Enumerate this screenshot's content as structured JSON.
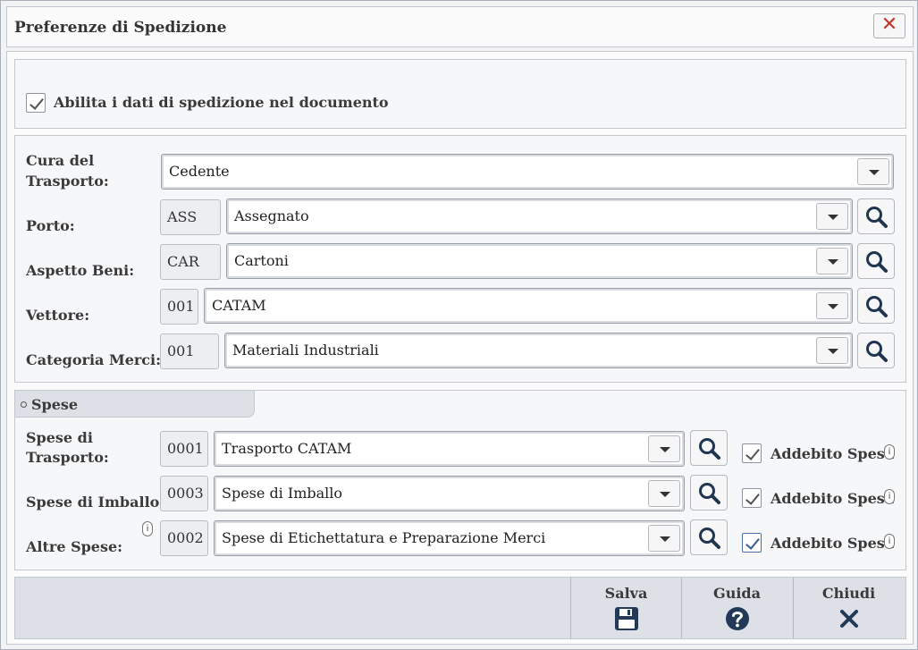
{
  "window": {
    "title": "Preferenze di Spedizione",
    "close_symbol": "✕"
  },
  "enable": {
    "label": "Abilita i dati di spedizione nel documento",
    "checked": true
  },
  "transport": {
    "cura": {
      "label_1": "Cura del",
      "label_2": "Trasporto:",
      "value": "Cedente"
    },
    "porto": {
      "label": "Porto:",
      "code": "ASS",
      "value": "Assegnato"
    },
    "aspetto": {
      "label": "Aspetto Beni:",
      "code": "CAR",
      "value": "Cartoni"
    },
    "vettore": {
      "label": "Vettore:",
      "code": "001",
      "value": "CATAM"
    },
    "categoria": {
      "label": "Categoria Merci:",
      "code": "001",
      "value": "Materiali Industriali"
    }
  },
  "spese": {
    "section_title": "Spese",
    "trasporto": {
      "label_1": "Spese di",
      "label_2": "Trasporto:",
      "code": "0001",
      "value": "Trasporto CATAM",
      "addebito_label": "Addebito Spesa",
      "checked": true
    },
    "imballo": {
      "label": "Spese di Imballo:",
      "code": "0003",
      "value": "Spese di Imballo",
      "addebito_label": "Addebito Spesa",
      "checked": true
    },
    "altre": {
      "label": "Altre Spese:",
      "code": "0002",
      "value": "Spese di Etichettatura e Preparazione Merci",
      "addebito_label": "Addebito Spesa",
      "checked": true
    },
    "info_glyph": "i"
  },
  "footer": {
    "save_label": "Salva",
    "help_label": "Guida",
    "close_label": "Chiudi"
  },
  "colors": {
    "close_x": "#c0392b",
    "accent_checkbox": "#3b5f94"
  }
}
